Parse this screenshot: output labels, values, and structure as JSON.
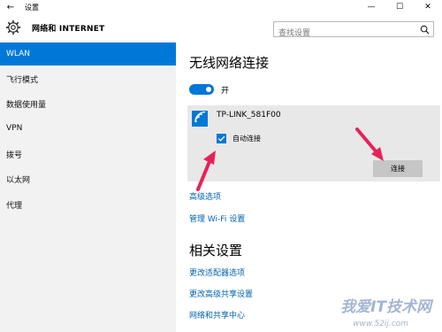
{
  "window": {
    "back_icon": "←",
    "title": "设置",
    "minimize_icon": "—",
    "maximize_icon": "☐",
    "close_icon": "✕"
  },
  "header": {
    "section_title": "网络和 INTERNET",
    "search_placeholder": "查找设置"
  },
  "sidebar": {
    "items": [
      {
        "label": "WLAN",
        "active": true
      },
      {
        "label": "飞行模式"
      },
      {
        "label": "数据使用量"
      },
      {
        "label": "VPN"
      },
      {
        "label": "拨号"
      },
      {
        "label": "以太网"
      },
      {
        "label": "代理"
      }
    ]
  },
  "main": {
    "wireless_title": "无线网络连接",
    "wifi_toggle_label": "开",
    "wifi_toggle_on": true,
    "network": {
      "ssid": "TP-LINK_581F00",
      "auto_connect_label": "自动连接",
      "auto_connect_checked": true,
      "connect_label": "连接"
    },
    "advanced_options": "高级选项",
    "manage_wifi": "管理 Wi-Fi 设置",
    "related_title": "相关设置",
    "related_links": [
      "更改适配器选项",
      "更改高级共享设置",
      "网络和共享中心"
    ]
  },
  "watermark": {
    "text": "我爱IT技术网",
    "url": "www.52ij.com"
  },
  "colors": {
    "accent": "#0078d7",
    "link": "#0063b1",
    "annotation": "#e8215a"
  }
}
